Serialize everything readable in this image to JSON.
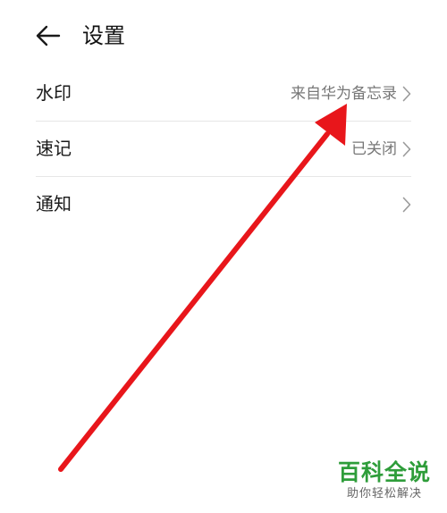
{
  "header": {
    "title": "设置",
    "back_icon": "arrow-left-icon"
  },
  "settings": {
    "items": [
      {
        "label": "水印",
        "value": "来自华为备忘录",
        "icon": "chevron-right-icon"
      },
      {
        "label": "速记",
        "value": "已关闭",
        "icon": "chevron-right-icon"
      },
      {
        "label": "通知",
        "value": "",
        "icon": "chevron-right-icon"
      }
    ]
  },
  "annotation": {
    "icon": "red-arrow-icon",
    "color": "#e8161b"
  },
  "watermark": {
    "title": "百科全说",
    "subtitle": "助你轻松解决",
    "color": "#2e9d3a"
  }
}
